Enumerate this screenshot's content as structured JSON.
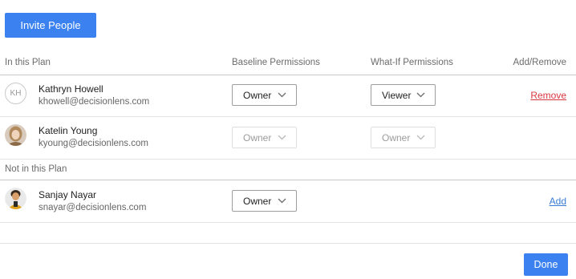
{
  "toolbar": {
    "invite_label": "Invite People"
  },
  "columns": {
    "plan": "In this Plan",
    "baseline": "Baseline Permissions",
    "whatif": "What-If Permissions",
    "addremove": "Add/Remove"
  },
  "in_plan": [
    {
      "initials": "KH",
      "name": "Kathryn Howell",
      "email": "khowell@decisionlens.com",
      "baseline": "Owner",
      "whatif": "Viewer",
      "action": "Remove"
    },
    {
      "name": "Katelin Young",
      "email": "kyoung@decisionlens.com",
      "baseline": "Owner",
      "whatif": "Owner"
    }
  ],
  "not_in_plan_label": "Not in this Plan",
  "not_in_plan": [
    {
      "name": "Sanjay Nayar",
      "email": "snayar@decisionlens.com",
      "baseline": "Owner",
      "action": "Add"
    }
  ],
  "footer": {
    "done_label": "Done"
  },
  "colors": {
    "accent": "#3b82f0",
    "remove": "#d9363e",
    "add_link": "#3a7bd5"
  }
}
